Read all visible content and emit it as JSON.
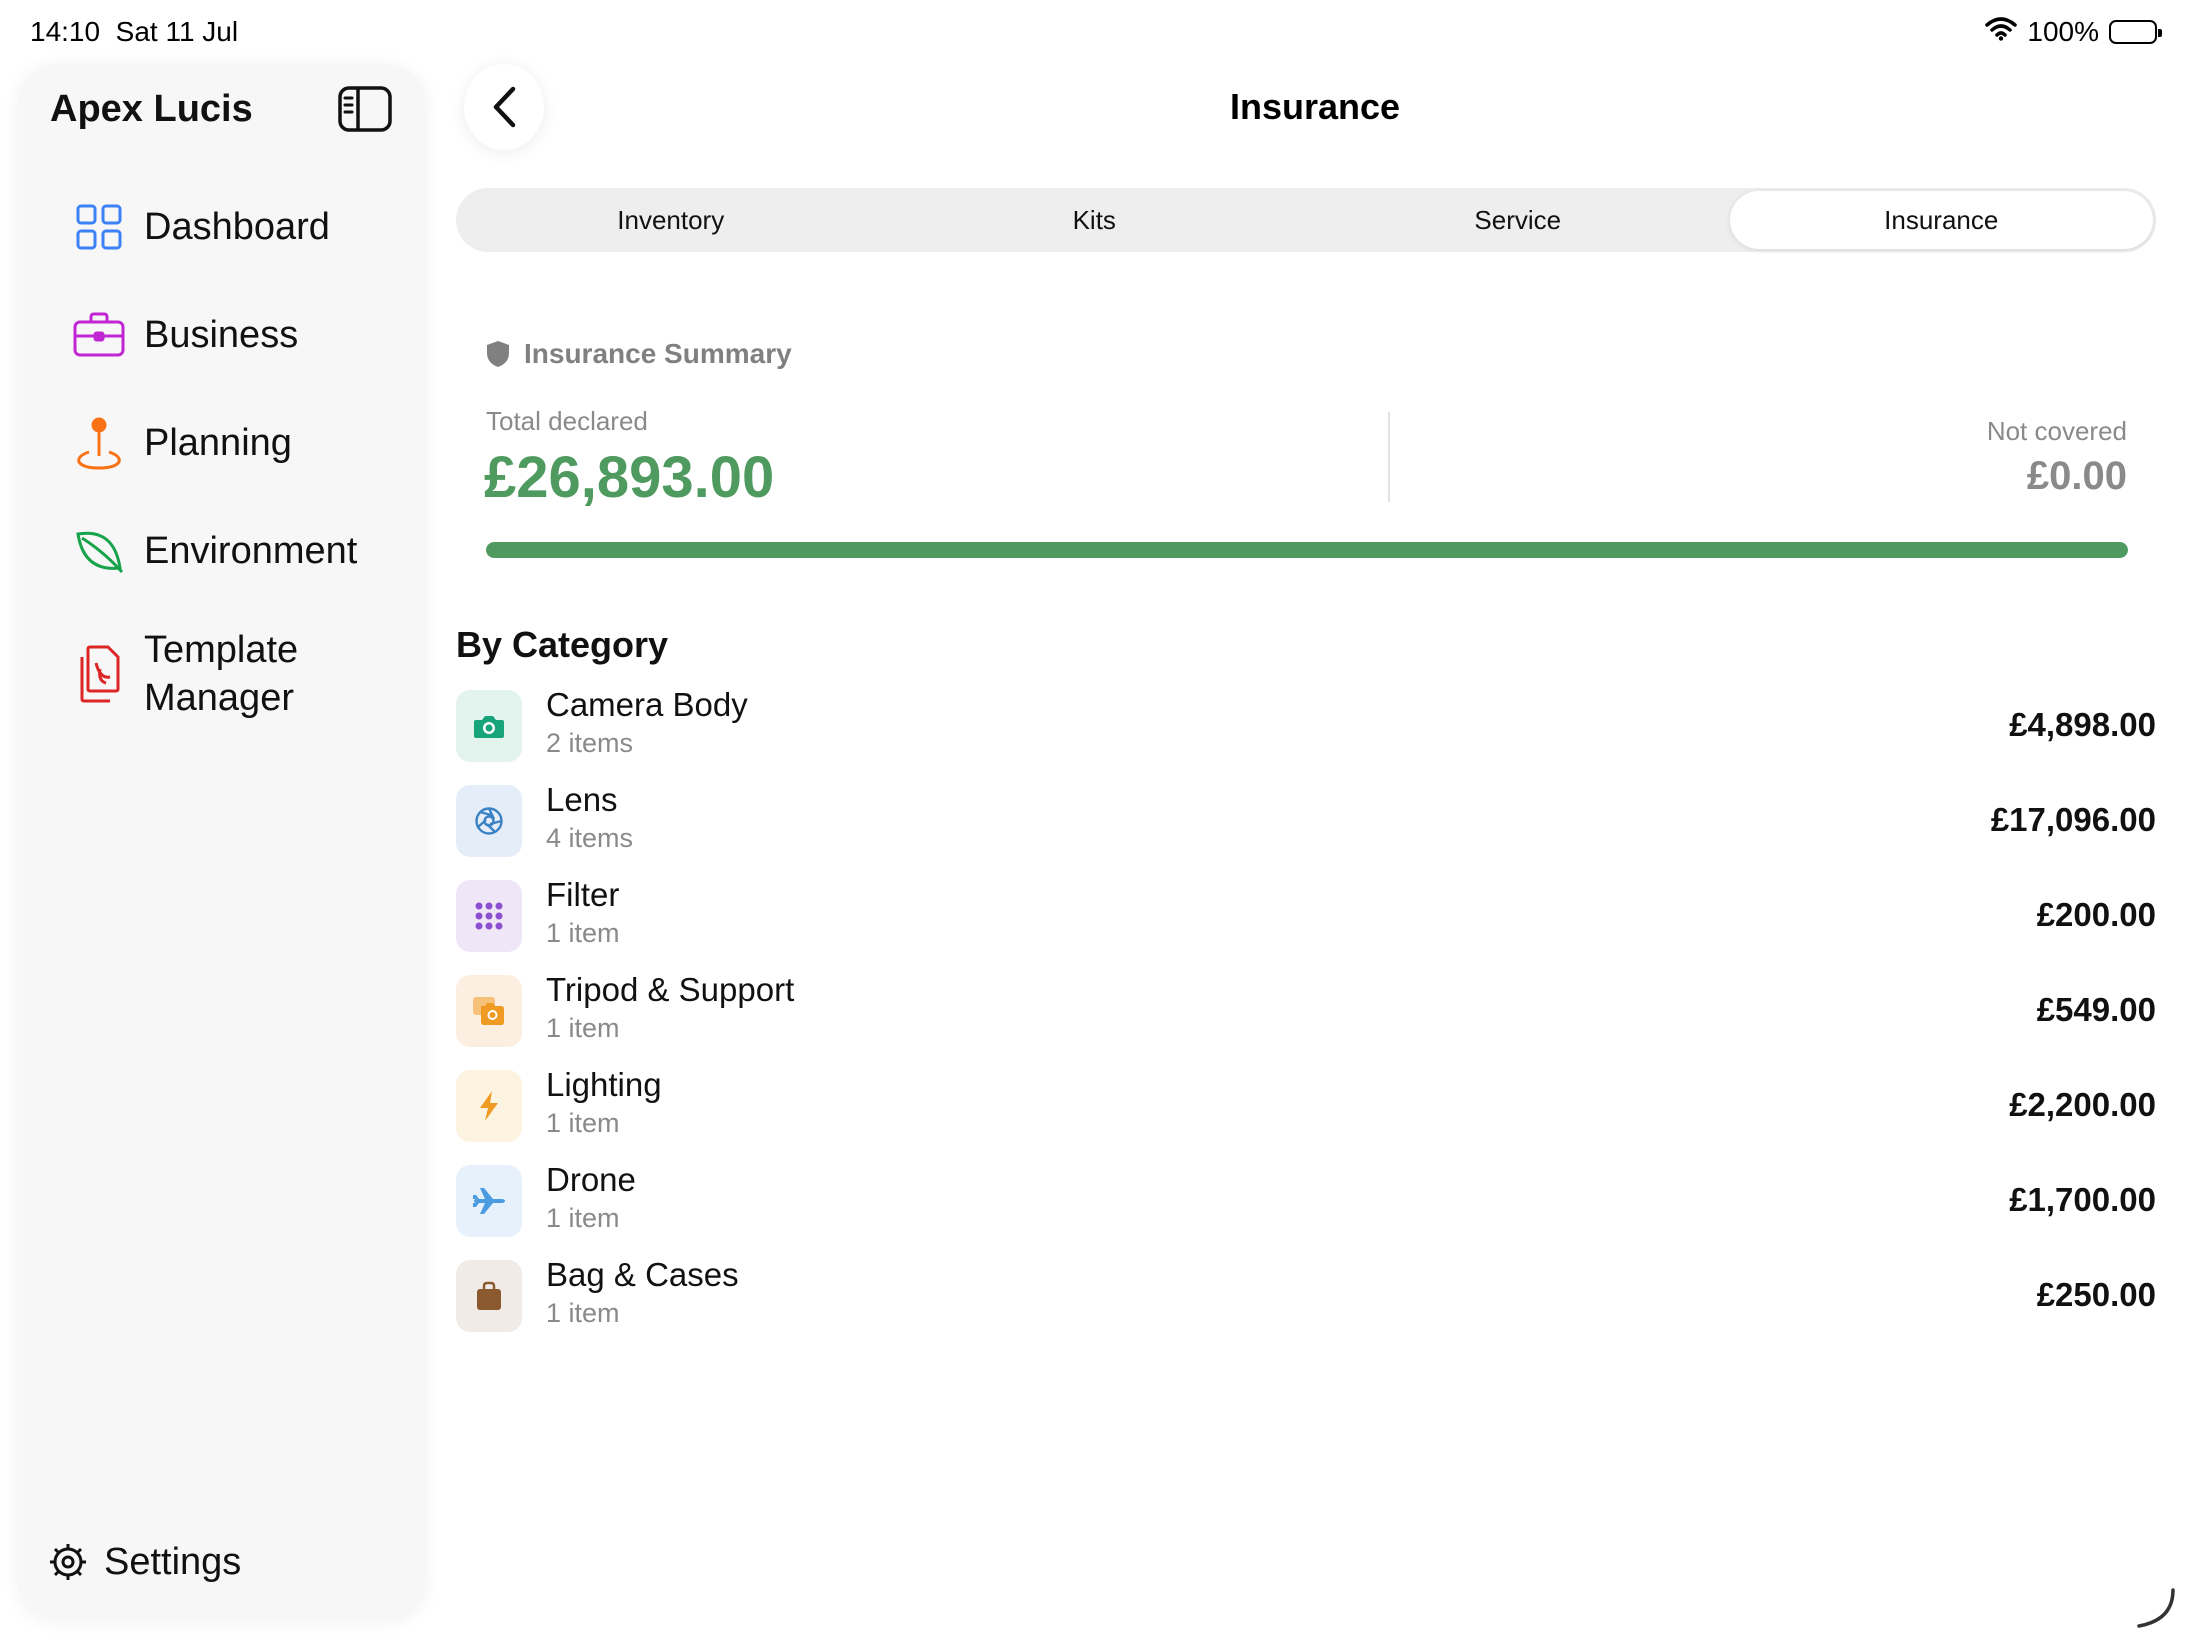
{
  "status_bar": {
    "time": "14:10",
    "date": "Sat 11 Jul",
    "battery": "100%"
  },
  "sidebar": {
    "title": "Apex Lucis",
    "items": [
      {
        "label": "Dashboard",
        "icon": "grid-icon",
        "color": "#3b82f6"
      },
      {
        "label": "Business",
        "icon": "briefcase-icon",
        "color": "#c026d3"
      },
      {
        "label": "Planning",
        "icon": "map-pin-icon",
        "color": "#f97316"
      },
      {
        "label": "Environment",
        "icon": "leaf-icon",
        "color": "#16a34a"
      },
      {
        "label": "Template Manager",
        "icon": "documents-icon",
        "color": "#dc2626"
      }
    ],
    "settings_label": "Settings"
  },
  "header": {
    "title": "Insurance"
  },
  "tabs": [
    {
      "label": "Inventory",
      "active": false
    },
    {
      "label": "Kits",
      "active": false
    },
    {
      "label": "Service",
      "active": false
    },
    {
      "label": "Insurance",
      "active": true
    }
  ],
  "summary": {
    "title": "Insurance Summary",
    "total_label": "Total declared",
    "total_value": "£26,893.00",
    "not_covered_label": "Not covered",
    "not_covered_value": "£0.00",
    "coverage_fraction": 1.0,
    "accent_color": "#4e9a5f"
  },
  "by_category": {
    "title": "By Category",
    "rows": [
      {
        "name": "Camera Body",
        "count": "2 items",
        "value": "£4,898.00",
        "icon": "camera-icon",
        "color": "#17a47b",
        "bg": "#e3f4ee"
      },
      {
        "name": "Lens",
        "count": "4 items",
        "value": "£17,096.00",
        "icon": "aperture-icon",
        "color": "#3b82c4",
        "bg": "#e5eef8"
      },
      {
        "name": "Filter",
        "count": "1 item",
        "value": "£200.00",
        "icon": "dots-grid-icon",
        "color": "#8b4fcf",
        "bg": "#efe6f8"
      },
      {
        "name": "Tripod & Support",
        "count": "1 item",
        "value": "£549.00",
        "icon": "photos-icon",
        "color": "#ef9a22",
        "bg": "#fcefe1"
      },
      {
        "name": "Lighting",
        "count": "1 item",
        "value": "£2,200.00",
        "icon": "bolt-icon",
        "color": "#ef9a22",
        "bg": "#fcf3e1"
      },
      {
        "name": "Drone",
        "count": "1 item",
        "value": "£1,700.00",
        "icon": "airplane-icon",
        "color": "#4b9be0",
        "bg": "#e7f1fb"
      },
      {
        "name": "Bag & Cases",
        "count": "1 item",
        "value": "£250.00",
        "icon": "bag-icon",
        "color": "#8a5a2e",
        "bg": "#f0ebe6"
      }
    ]
  }
}
